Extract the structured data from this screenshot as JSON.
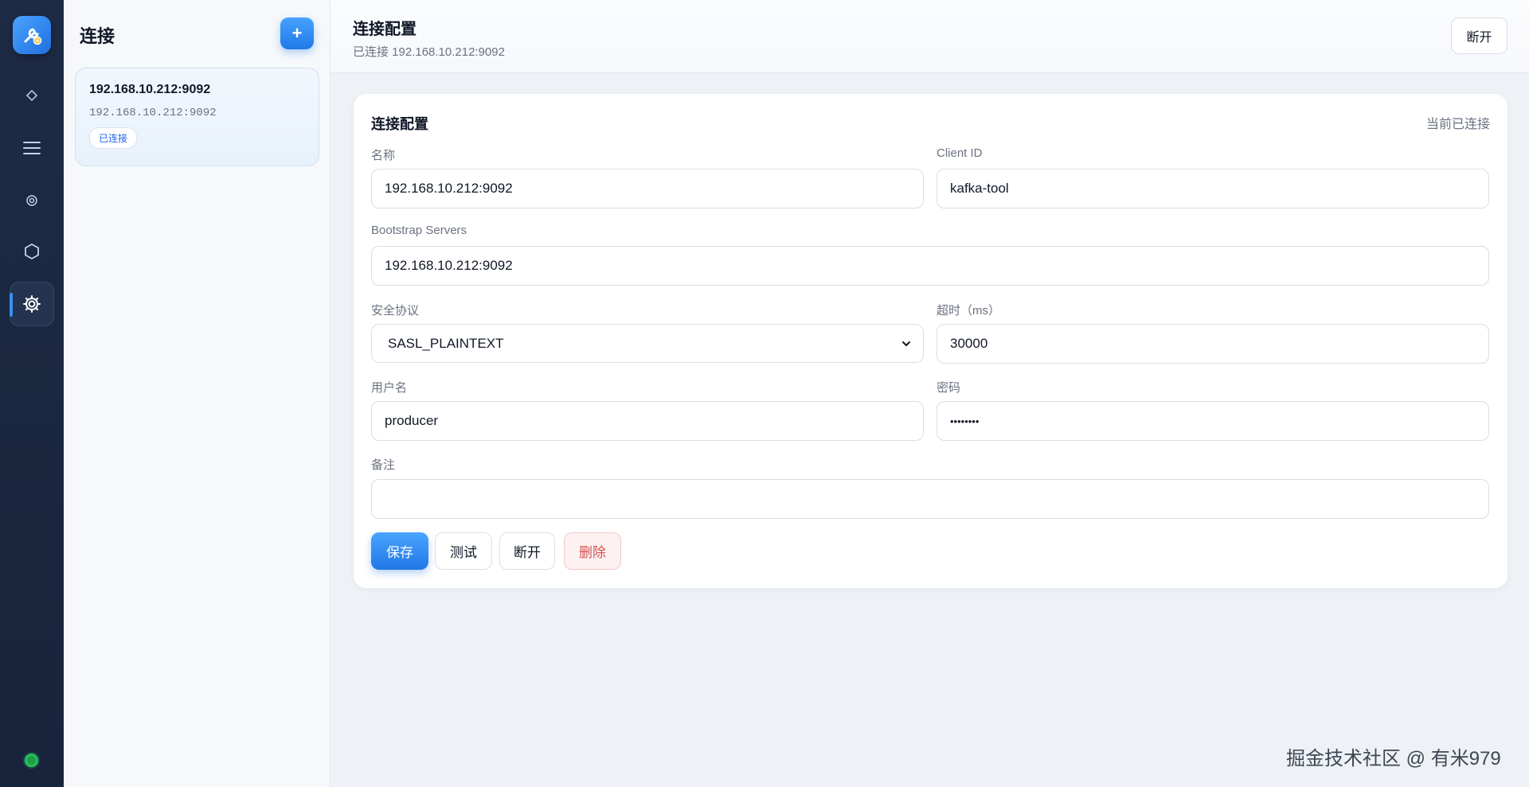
{
  "rail": {
    "items": [
      {
        "name": "nav-overview",
        "icon": "diamond-icon",
        "glyph": "◇"
      },
      {
        "name": "nav-topics",
        "icon": "menu-icon",
        "glyph": "☰"
      },
      {
        "name": "nav-consumers",
        "icon": "target-icon",
        "glyph": "◎"
      },
      {
        "name": "nav-brokers",
        "icon": "hexagon-icon",
        "glyph": "⬡"
      },
      {
        "name": "nav-settings",
        "icon": "gear-icon",
        "glyph": "⚙"
      }
    ]
  },
  "connections": {
    "title": "连接",
    "add_label": "+",
    "items": [
      {
        "name": "192.168.10.212:9092",
        "address": "192.168.10.212:9092",
        "status": "已连接"
      }
    ]
  },
  "header": {
    "title": "连接配置",
    "subtitle": "已连接 192.168.10.212:9092",
    "disconnect_label": "断开"
  },
  "form": {
    "title": "连接配置",
    "status": "当前已连接",
    "name_label": "名称",
    "name_value": "192.168.10.212:9092",
    "client_id_label": "Client ID",
    "client_id_value": "kafka-tool",
    "bootstrap_label": "Bootstrap Servers",
    "bootstrap_value": "192.168.10.212:9092",
    "protocol_label": "安全协议",
    "protocol_value": "SASL_PLAINTEXT",
    "timeout_label": "超时（ms）",
    "timeout_value": "30000",
    "username_label": "用户名",
    "username_value": "producer",
    "password_label": "密码",
    "password_value": "••••••••",
    "remark_label": "备注",
    "remark_value": "",
    "save_label": "保存",
    "test_label": "测试",
    "disconnect_label": "断开",
    "delete_label": "删除"
  },
  "watermark": "掘金技术社区 @ 有米979",
  "colors": {
    "accent": "#2f8cf2",
    "rail_bg": "#1b2840",
    "connected": "#23c25b",
    "danger": "#d55050"
  }
}
